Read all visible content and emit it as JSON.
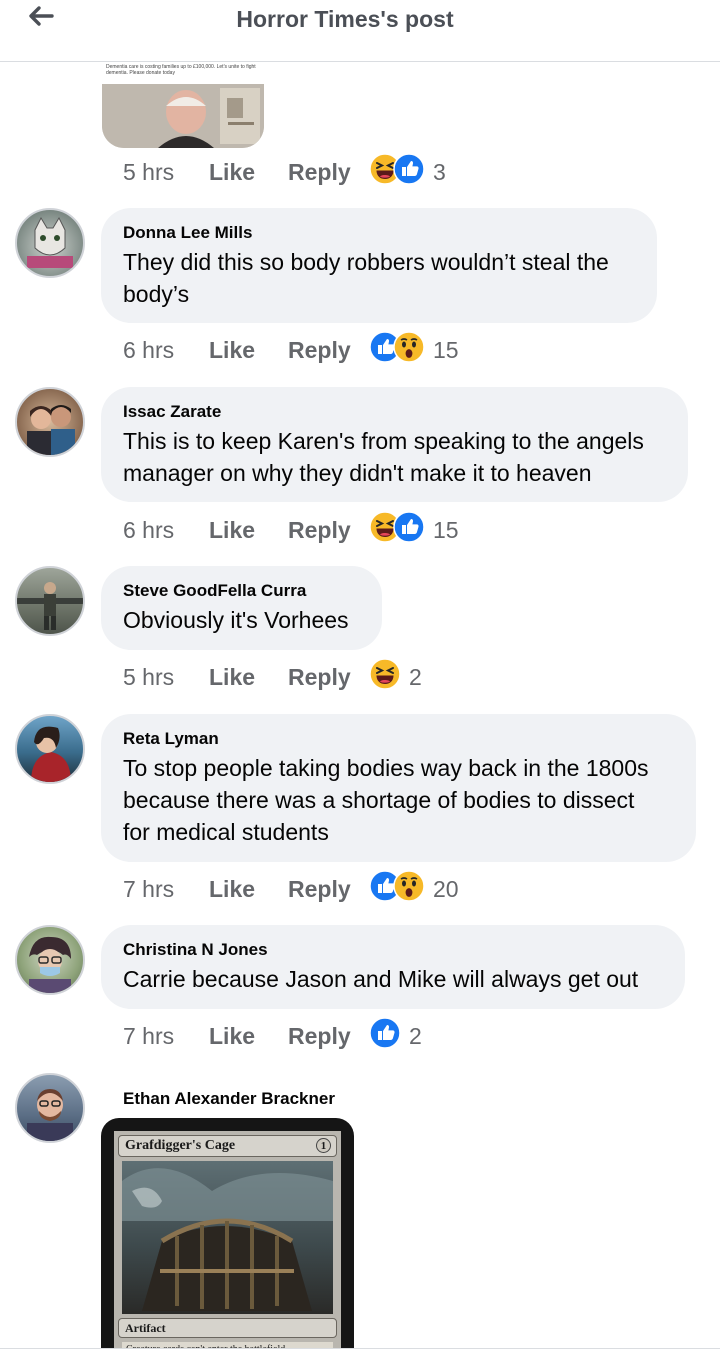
{
  "header": {
    "title": "Horror Times's post"
  },
  "top_image": {
    "caption": "Dementia care is costing families up to £100,000. Let's unite to fight dementia. Please donate today"
  },
  "first_actions": {
    "time": "5 hrs",
    "like": "Like",
    "reply": "Reply",
    "count": "3"
  },
  "comments": [
    {
      "author": "Donna Lee Mills",
      "text_lines": [
        "They did this so body robbers wouldn’t steal the",
        "body’s"
      ],
      "time": "6 hrs",
      "like": "Like",
      "reply": "Reply",
      "count": "15",
      "reactions": [
        "like-icon",
        "wow-icon"
      ]
    },
    {
      "author": "Issac Zarate",
      "text_lines": [
        "This is to keep Karen's from speaking to the angels",
        "manager on why they didn't make it to heaven"
      ],
      "time": "6 hrs",
      "like": "Like",
      "reply": "Reply",
      "count": "15",
      "reactions": [
        "haha-icon",
        "like-icon"
      ]
    },
    {
      "author": "Steve GoodFella Curra",
      "text_lines": [
        "Obviously it's Vorhees"
      ],
      "time": "5 hrs",
      "like": "Like",
      "reply": "Reply",
      "count": "2",
      "reactions": [
        "haha-icon"
      ]
    },
    {
      "author": "Reta Lyman",
      "text_lines": [
        "To stop people taking bodies way back in the 1800s",
        "because there was a shortage of bodies to dissect",
        "for medical students"
      ],
      "time": "7 hrs",
      "like": "Like",
      "reply": "Reply",
      "count": "20",
      "reactions": [
        "like-icon",
        "wow-icon"
      ]
    },
    {
      "author": "Christina N Jones",
      "text_lines": [
        "Carrie because Jason and Mike will always get out"
      ],
      "time": "7 hrs",
      "like": "Like",
      "reply": "Reply",
      "count": "2",
      "reactions": [
        "like-icon"
      ]
    },
    {
      "author": "Ethan Alexander Brackner"
    }
  ],
  "card": {
    "name": "Grafdigger's Cage",
    "mana": "1",
    "type": "Artifact",
    "rules_text": "Creature cards can't enter the battlefield"
  },
  "colors": {
    "like_blue": "#1877f2",
    "haha_yellow": "#f7b928",
    "bubble_gray": "#f0f2f5",
    "meta_gray": "#65676b"
  }
}
